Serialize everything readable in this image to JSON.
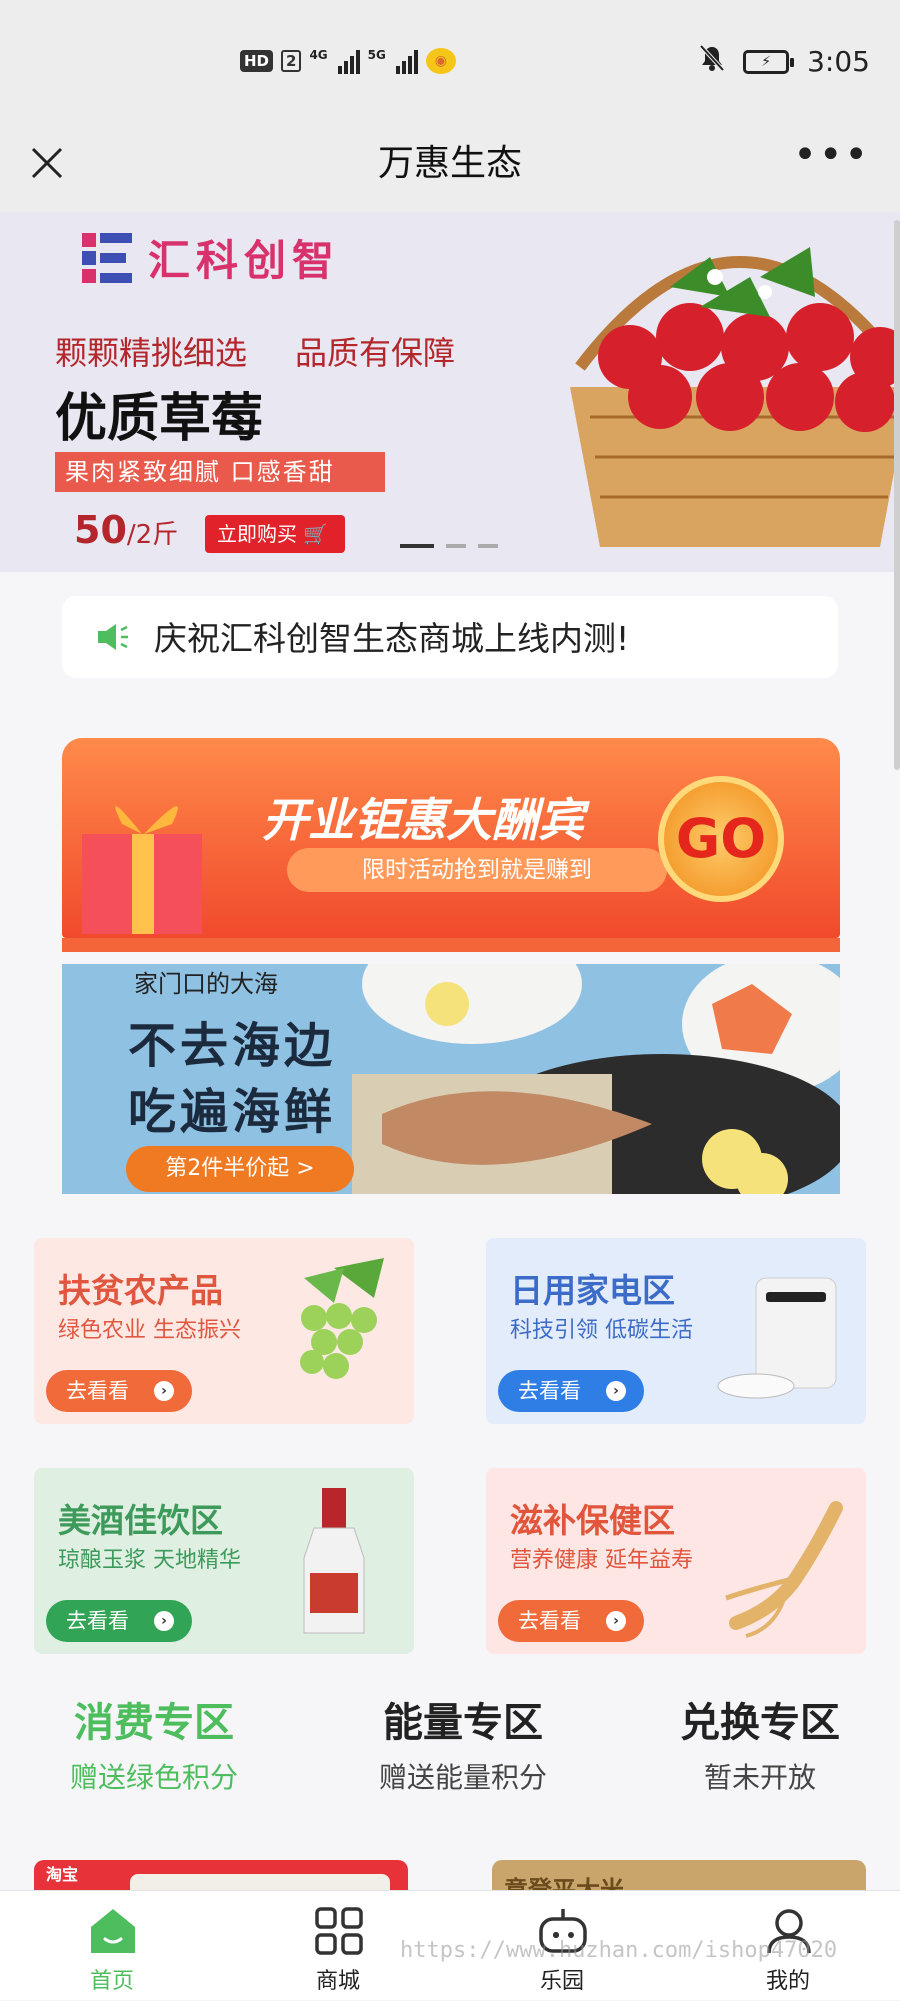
{
  "status_bar": {
    "hd": "HD",
    "sim": "2",
    "net1": "4G",
    "net2": "5G",
    "time": "3:05"
  },
  "header": {
    "title": "万惠生态",
    "close_icon": "close-icon",
    "more_icon": "more-icon",
    "more_label": "•••"
  },
  "banner": {
    "brand": "汇科创智",
    "line1": "颗颗精挑细选",
    "line1b": "品质有保障",
    "headline": "优质草莓",
    "tagline": "果肉紧致细腻  口感香甜",
    "price": "50",
    "price_unit": "/2斤",
    "buy_label": "立即购买",
    "slides": 3,
    "active_slide": 1
  },
  "notice": {
    "text": "庆祝汇科创智生态商城上线内测!",
    "icon": "speaker-icon"
  },
  "promo": {
    "title": "开业钜惠大酬宾",
    "subtitle": "限时活动抢到就是赚到",
    "go": "GO"
  },
  "seafood": {
    "small": "家门口的大海",
    "line1": "不去海边",
    "line2": "吃遍海鲜",
    "button": "第2件半价起 >"
  },
  "cards": [
    {
      "title": "扶贫农产品",
      "sub": "绿色农业 生态振兴",
      "button": "去看看",
      "bg": "#fde8e4",
      "title_color": "#e0573f",
      "sub_color": "#e0573f",
      "btn_color": "#f06a3a"
    },
    {
      "title": "日用家电区",
      "sub": "科技引领 低碳生活",
      "button": "去看看",
      "bg": "#e3ecfb",
      "title_color": "#3c6cc8",
      "sub_color": "#3c6cc8",
      "btn_color": "#2f7ee6"
    },
    {
      "title": "美酒佳饮区",
      "sub": "琼酿玉浆 天地精华",
      "button": "去看看",
      "bg": "#dff0e3",
      "title_color": "#3d9a5a",
      "sub_color": "#3d9a5a",
      "btn_color": "#31a455"
    },
    {
      "title": "滋补保健区",
      "sub": "营养健康 延年益寿",
      "button": "去看看",
      "bg": "#fde6e4",
      "title_color": "#e0553b",
      "sub_color": "#e0553b",
      "btn_color": "#f06a3a"
    }
  ],
  "zones": [
    {
      "title": "消费专区",
      "sub": "赠送绿色积分",
      "color": "#4ebd5e"
    },
    {
      "title": "能量专区",
      "sub": "赠送能量积分",
      "color": "#222222"
    },
    {
      "title": "兑换专区",
      "sub": "暂未开放",
      "color": "#222222"
    }
  ],
  "peek": {
    "left_tag": "淘宝",
    "right_text": "意登平大米"
  },
  "tabs": [
    {
      "label": "首页",
      "icon": "home-icon",
      "active": true
    },
    {
      "label": "商城",
      "icon": "grid-icon",
      "active": false
    },
    {
      "label": "乐园",
      "icon": "game-icon",
      "active": false
    },
    {
      "label": "我的",
      "icon": "user-icon",
      "active": false
    }
  ],
  "watermark": "https://www.huzhan.com/ishop47020",
  "colors": {
    "accent": "#4ebd5e",
    "brand": "#d8316c",
    "banner_red": "#b3262b"
  }
}
